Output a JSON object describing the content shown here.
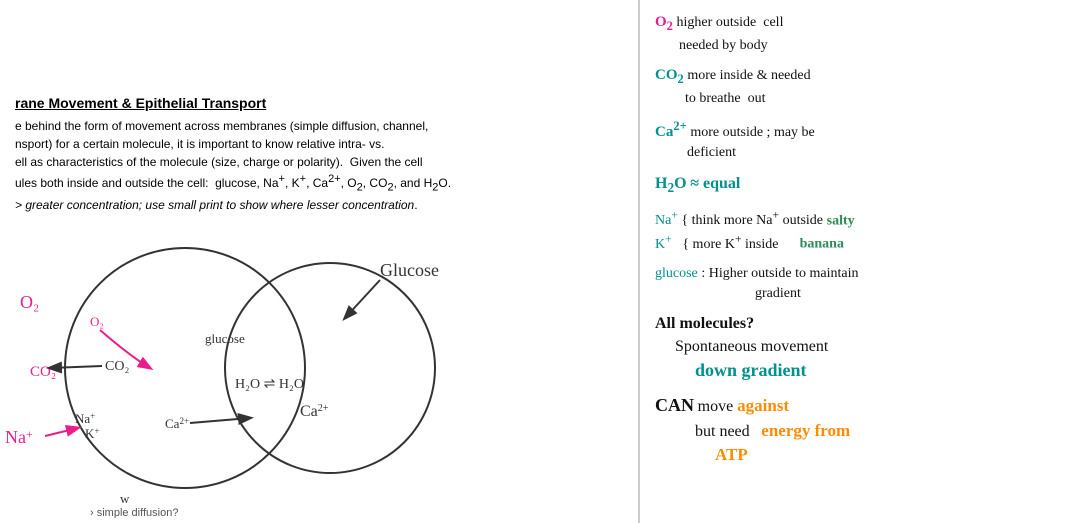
{
  "left": {
    "title": "rane Movement & Epithelial Transport",
    "body_lines": [
      "e behind the form of movement across membranes (simple diffusion, channel,",
      "nsport) for a certain molecule, it is important to know relative intra- vs.",
      "ell as characteristics of the molecule (size, charge or polarity).  Given the cell",
      "ules both inside and outside the cell:  glucose, Na⁺, K⁺, Ca²⁺, O₂, CO₂, and H₂O.",
      "› greater concentration; use small print to show where lesser concentration."
    ]
  },
  "right": {
    "annotations": [
      {
        "id": "o2-note",
        "molecule": "O₂",
        "text": "higher outside  cell\nneeded by body",
        "color": "pink"
      },
      {
        "id": "co2-note",
        "molecule": "CO₂",
        "text": "more inside & needed\nto breathe out",
        "color": "teal"
      },
      {
        "id": "ca2-note",
        "molecule": "Ca²⁺",
        "text": "more outside ; may be\ndeficient",
        "color": "teal"
      },
      {
        "id": "h2o-note",
        "molecule": "H₂O",
        "text": "≈ equal",
        "color": "teal"
      },
      {
        "id": "na-k-note",
        "molecule": "Na⁺ K⁺",
        "text": "think more Na⁺ outside",
        "text2": "more K⁺ inside",
        "label1": "salty",
        "label2": "banana",
        "color": "teal"
      },
      {
        "id": "glucose-note",
        "molecule": "glucose",
        "text": ": Higher outside to maintain\ngradient",
        "color": "teal"
      },
      {
        "id": "all-molecules-note",
        "line1": "All molecules?",
        "line2": "Spontaneous movement",
        "line3": "down gradient",
        "color": "black"
      },
      {
        "id": "can-note",
        "prefix": "CAN",
        "line1": "move against",
        "line2": "but need",
        "highlight1": "against",
        "highlight2": "energy from",
        "line3": "ATP",
        "color": "black"
      }
    ]
  }
}
